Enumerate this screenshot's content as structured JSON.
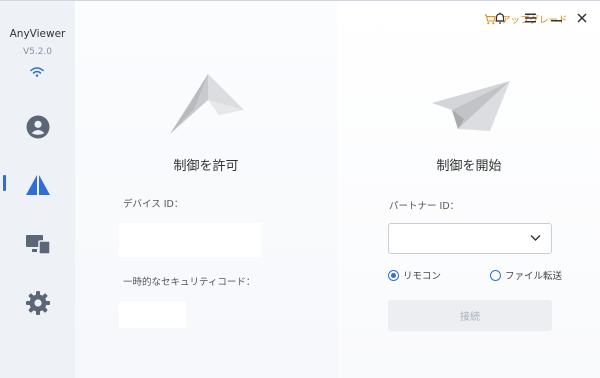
{
  "app": {
    "name": "AnyViewer",
    "version": "V5.2.0"
  },
  "titlebar": {
    "upgrade_label": "アップグレード"
  },
  "sidebar": {
    "items": [
      {
        "icon": "user-icon"
      },
      {
        "icon": "remote-control-icon",
        "active": true
      },
      {
        "icon": "devices-icon"
      },
      {
        "icon": "settings-icon"
      }
    ]
  },
  "allow_panel": {
    "title": "制御を許可",
    "device_id_label": "デバイス ID：",
    "security_code_label": "一時的なセキュリティコード："
  },
  "start_panel": {
    "title": "制御を開始",
    "partner_id_label": "パートナー ID：",
    "partner_id_value": "",
    "radio_remote": "リモコン",
    "radio_file": "ファイル転送",
    "selected_mode": "リモコン",
    "connect_label": "接続"
  },
  "colors": {
    "accent": "#2f6fd4",
    "upgrade": "#e58a1d",
    "sidebar_bg": "#eef1f6",
    "icon_gray": "#5b6678"
  }
}
